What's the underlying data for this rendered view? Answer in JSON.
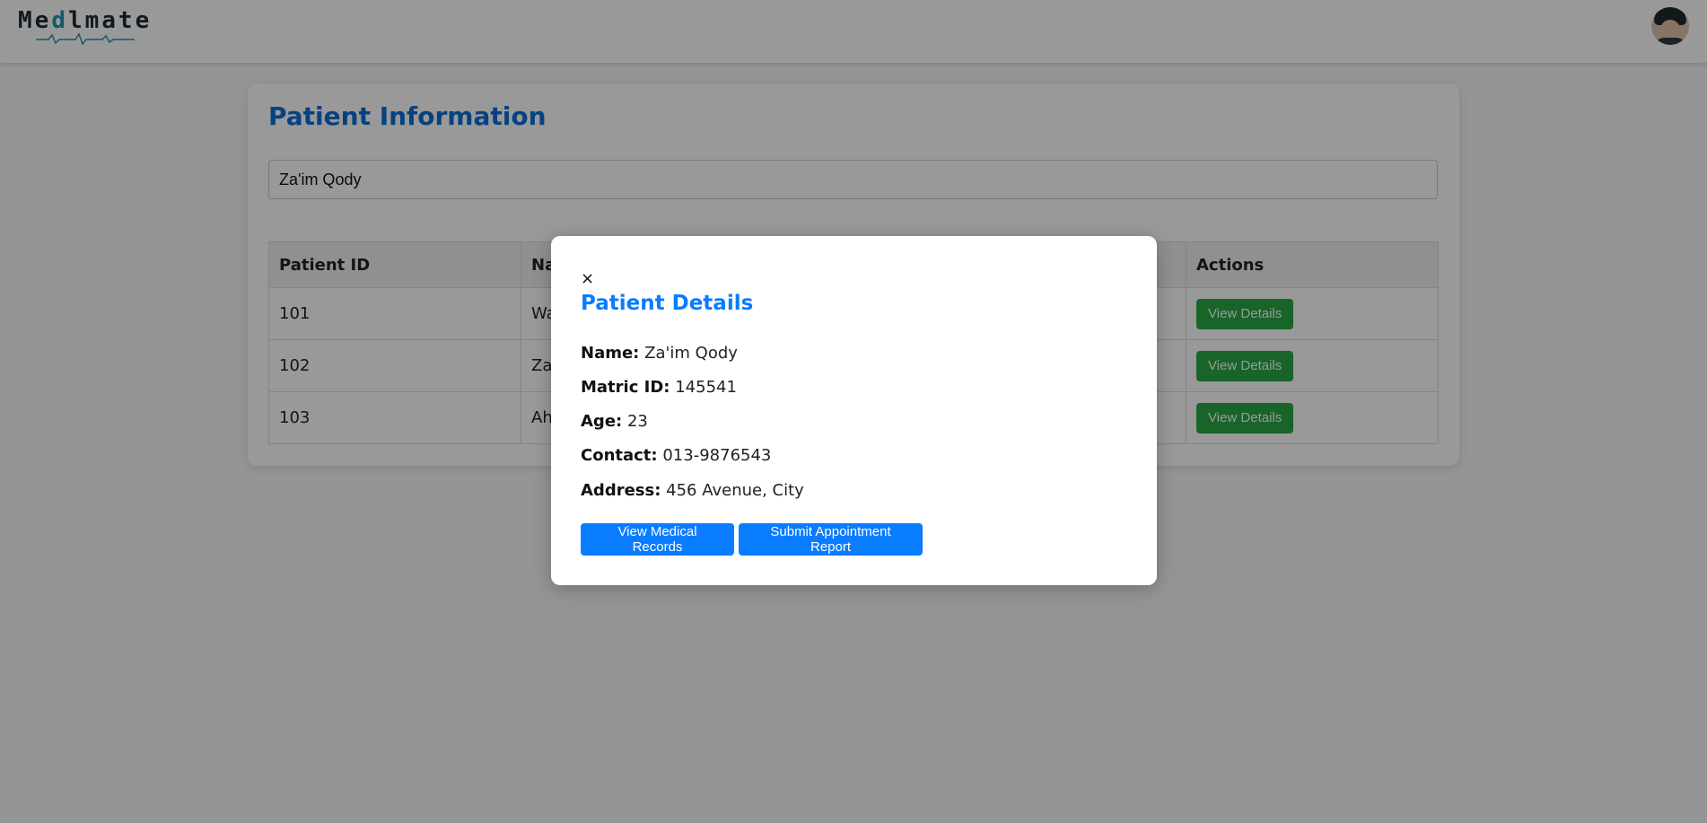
{
  "app": {
    "logo_prefix": "Me",
    "logo_accent": "d",
    "logo_suffix": "lmate"
  },
  "page": {
    "title": "Patient Information",
    "search_value": "Za'im Qody"
  },
  "table": {
    "headers": [
      "Patient ID",
      "Na",
      "Actions"
    ],
    "rows": [
      {
        "id": "101",
        "name": "Wa",
        "action": "View Details"
      },
      {
        "id": "102",
        "name": "Za",
        "action": "View Details"
      },
      {
        "id": "103",
        "name": "Ah",
        "action": "View Details"
      }
    ]
  },
  "modal": {
    "close": "×",
    "title": "Patient Details",
    "fields": [
      {
        "label": "Name:",
        "value": "Za'im Qody"
      },
      {
        "label": "Matric ID:",
        "value": "145541"
      },
      {
        "label": "Age:",
        "value": "23"
      },
      {
        "label": "Contact:",
        "value": "013-9876543"
      },
      {
        "label": "Address:",
        "value": "456 Avenue, City"
      }
    ],
    "view_records_label": "View Medical Records",
    "submit_report_label": "Submit Appointment Report"
  },
  "colors": {
    "accent_blue": "#0a7cff",
    "title_blue": "#0a6fd6",
    "action_green": "#28a745",
    "logo_teal": "#1b9aaa"
  }
}
